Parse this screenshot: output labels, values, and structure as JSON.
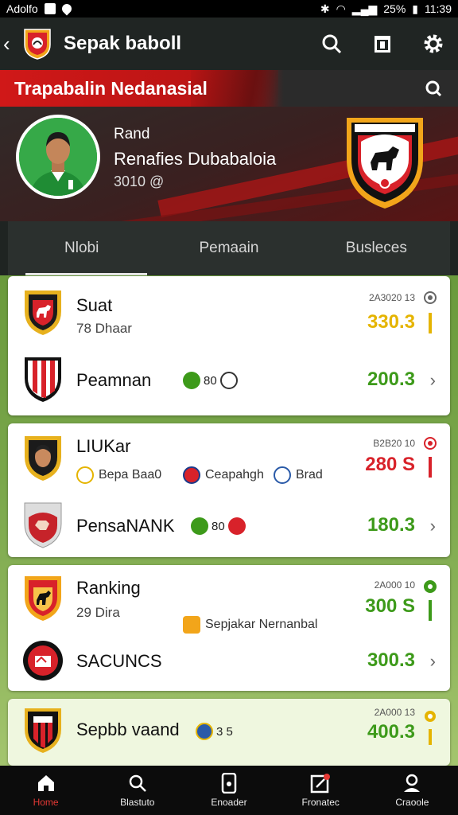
{
  "status_bar": {
    "carrier": "Adolfo",
    "battery": "25%",
    "time": "11:39"
  },
  "app_bar": {
    "title": "Sepak baboll"
  },
  "hero": {
    "banner_title": "Trapabalin Nedanasial",
    "player_label": "Rand",
    "player_name": "Renafies Dubabaloia",
    "player_stat": "3010 @"
  },
  "tabs": [
    {
      "label": "Nlobi",
      "active": true
    },
    {
      "label": "Pemaain",
      "active": false
    },
    {
      "label": "Busleces",
      "active": false
    }
  ],
  "cards": [
    {
      "rows": [
        {
          "title": "Suat",
          "sub": "78 Dhaar",
          "meta": "2A3020 13",
          "score": "330.3",
          "score_color": "#e5b400",
          "side_color": "#e5b400"
        },
        {
          "title": "Peamnan",
          "badge_text": "80",
          "score": "200.3",
          "score_color": "#3d9a1a"
        }
      ]
    },
    {
      "rows": [
        {
          "title": "LIUKar",
          "meta": "B2B20 10",
          "score": "280 S",
          "score_color": "#d8222a",
          "side_color": "#d8222a",
          "chips": [
            "Bepa Baa0",
            "Ceapahgh",
            "Brad"
          ]
        },
        {
          "title": "PensaNANK",
          "badge_text": "80",
          "score": "180.3",
          "score_color": "#3d9a1a"
        }
      ]
    },
    {
      "rows": [
        {
          "title": "Ranking",
          "sub": "29 Dira",
          "meta": "2A000 10",
          "score": "300 S",
          "score_color": "#3d9a1a",
          "side_color": "#3d9a1a",
          "chip": "Sepjakar Nernanbal"
        },
        {
          "title": "SACUNCS",
          "score": "300.3",
          "score_color": "#3d9a1a"
        }
      ]
    },
    {
      "rows": [
        {
          "title": "Sepbb vaand",
          "badge_text": "3 5",
          "meta": "2A000 13",
          "score": "400.3",
          "score_color": "#3d9a1a",
          "side_color": "#e5b400"
        }
      ]
    }
  ],
  "bottom_nav": [
    {
      "label": "Home",
      "icon": "home-icon",
      "active": true
    },
    {
      "label": "Blastuto",
      "icon": "search-icon",
      "active": false
    },
    {
      "label": "Enoader",
      "icon": "phone-icon",
      "active": false
    },
    {
      "label": "Fronatec",
      "icon": "edit-icon",
      "active": false
    },
    {
      "label": "Craoole",
      "icon": "profile-icon",
      "active": false
    }
  ]
}
